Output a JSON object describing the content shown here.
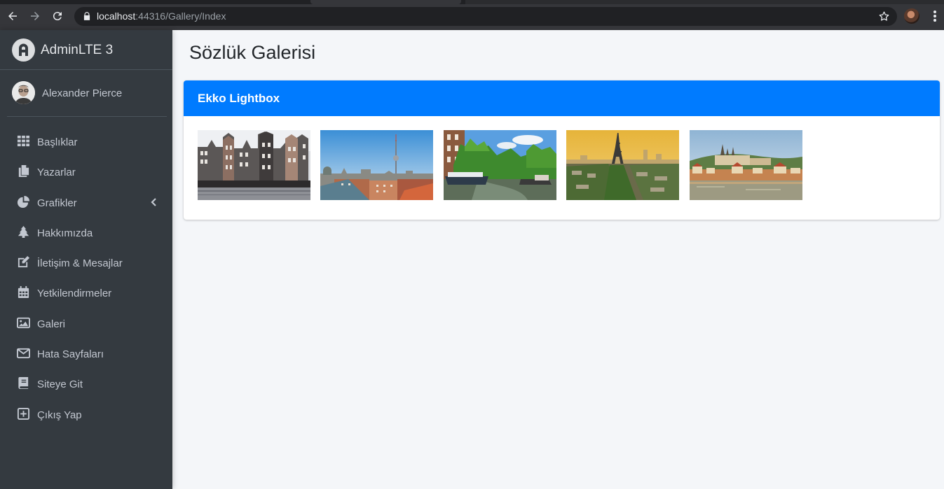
{
  "browser": {
    "url_host": "localhost",
    "url_rest": ":44316/Gallery/Index",
    "icons": [
      "back-arrow-icon",
      "forward-arrow-icon",
      "reload-icon",
      "lock-icon",
      "star-icon",
      "profile-avatar",
      "kebab-menu-icon"
    ]
  },
  "sidebar": {
    "brand": "AdminLTE 3",
    "user": "Alexander Pierce",
    "items": [
      {
        "label": "Başlıklar",
        "icon": "th-grid-icon"
      },
      {
        "label": "Yazarlar",
        "icon": "copy-icon"
      },
      {
        "label": "Grafikler",
        "icon": "chart-pie-icon"
      },
      {
        "label": "Hakkımızda",
        "icon": "tree-icon"
      },
      {
        "label": "İletişim & Mesajlar",
        "icon": "edit-icon"
      },
      {
        "label": "Yetkilendirmeler",
        "icon": "calendar-icon"
      },
      {
        "label": "Galeri",
        "icon": "image-icon"
      },
      {
        "label": "Hata Sayfaları",
        "icon": "envelope-icon"
      },
      {
        "label": "Siteye Git",
        "icon": "book-icon"
      },
      {
        "label": "Çıkış Yap",
        "icon": "plus-square-icon"
      }
    ]
  },
  "main": {
    "title": "Sözlük Galerisi",
    "card_title": "Ekko Lightbox",
    "images": [
      {
        "name": "amsterdam-canal-houses"
      },
      {
        "name": "berlin-tv-tower-skyline"
      },
      {
        "name": "amsterdam-canal-boats"
      },
      {
        "name": "paris-eiffel-tower"
      },
      {
        "name": "prague-castle-riverside"
      }
    ]
  },
  "colors": {
    "sidebar_bg": "#343a40",
    "content_bg": "#f4f6f9",
    "card_header": "#007bff",
    "sidebar_text": "#c2c7d0"
  }
}
